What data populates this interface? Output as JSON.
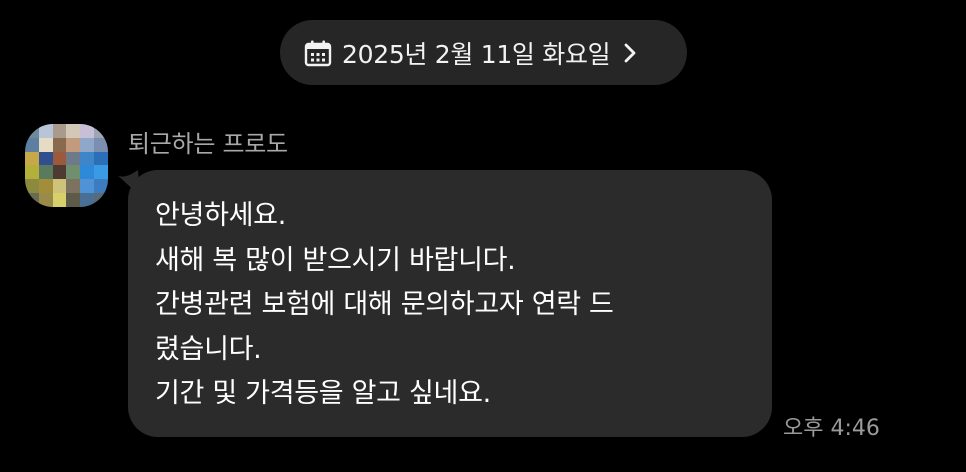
{
  "date_header": {
    "label": "2025년 2월 11일 화요일",
    "icon": "calendar-icon",
    "chevron": "chevron-right-icon"
  },
  "message": {
    "sender_name": "퇴근하는 프로도",
    "lines": [
      "안녕하세요.",
      "새해 복 많이 받으시기 바랍니다.",
      "간병관련 보험에 대해 문의하고자 연락 드",
      "렸습니다.",
      "기간 및 가격등을 알고 싶네요."
    ],
    "time": "오후 4:46"
  },
  "colors": {
    "background": "#000000",
    "bubble": "#2b2b2b",
    "pill": "#262626",
    "secondary_text": "#a8a8a8"
  }
}
